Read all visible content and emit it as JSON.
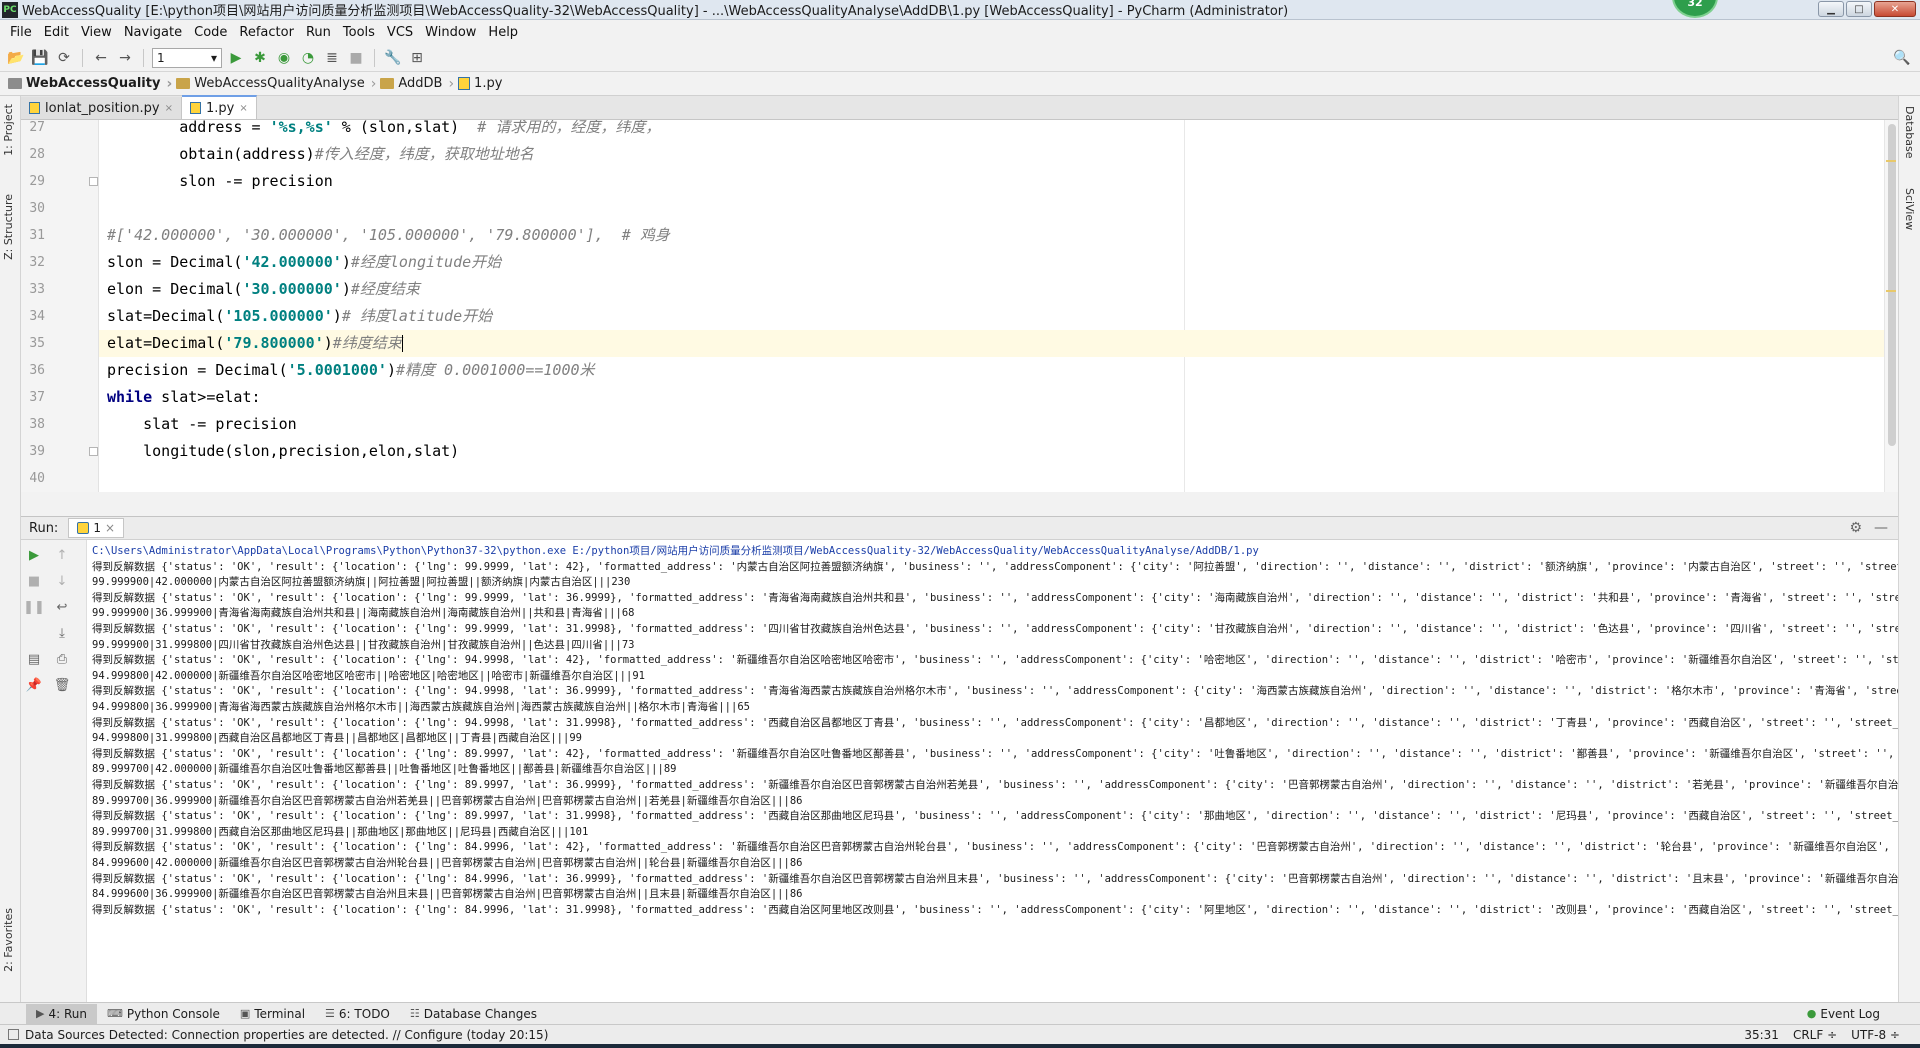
{
  "window": {
    "title": "WebAccessQuality [E:\\python项目\\网站用户访问质量分析监测项目\\WebAccessQuality-32\\WebAccessQuality] - ...\\WebAccessQualityAnalyse\\AddDB\\1.py [WebAccessQuality] - PyCharm (Administrator)",
    "app_icon_label": "PC",
    "badge": "32",
    "controls": {
      "minimize": "▁",
      "maximize": "□",
      "close": "✕"
    }
  },
  "menu": [
    "File",
    "Edit",
    "View",
    "Navigate",
    "Code",
    "Refactor",
    "Run",
    "Tools",
    "VCS",
    "Window",
    "Help"
  ],
  "toolbar": {
    "run_config": "1",
    "icons": [
      "open-icon",
      "save-icon",
      "sync-icon",
      "back-icon",
      "forward-icon",
      "run-icon",
      "debug-icon",
      "coverage-icon",
      "profile-icon",
      "concurrency-icon",
      "stop-icon",
      "settings-icon",
      "structure-icon",
      "search-icon"
    ]
  },
  "breadcrumb": [
    "WebAccessQuality",
    "WebAccessQualityAnalyse",
    "AddDB",
    "1.py"
  ],
  "left_tabs": {
    "project": "1: Project",
    "structure": "Z: Structure",
    "favorites": "2: Favorites"
  },
  "right_tabs": {
    "database": "Database",
    "sciview": "SciView"
  },
  "editor_tabs": [
    {
      "label": "lonlat_position.py",
      "active": false
    },
    {
      "label": "1.py",
      "active": true
    }
  ],
  "code": {
    "lines": [
      {
        "no": "27",
        "parts": [
          {
            "t": "        address = ",
            "c": ""
          },
          {
            "t": "'%s,%s'",
            "c": "str"
          },
          {
            "t": " % (slon,slat)  ",
            "c": ""
          },
          {
            "t": "# 请求用的，经度，纬度，",
            "c": "cmt"
          }
        ]
      },
      {
        "no": "28",
        "parts": [
          {
            "t": "        obtain(address)",
            "c": ""
          },
          {
            "t": "#传入经度，纬度，获取地址地名",
            "c": "cmt"
          }
        ]
      },
      {
        "no": "29",
        "parts": [
          {
            "t": "        slon -= precision",
            "c": ""
          }
        ]
      },
      {
        "no": "30",
        "parts": []
      },
      {
        "no": "31",
        "parts": [
          {
            "t": "#['42.000000', '30.000000', '105.000000', '79.800000'],  # 鸡身",
            "c": "cmt"
          }
        ]
      },
      {
        "no": "32",
        "parts": [
          {
            "t": "slon = Decimal(",
            "c": ""
          },
          {
            "t": "'42.000000'",
            "c": "str"
          },
          {
            "t": ")",
            "c": ""
          },
          {
            "t": "#经度longitude开始",
            "c": "cmt"
          }
        ]
      },
      {
        "no": "33",
        "parts": [
          {
            "t": "elon = Decimal(",
            "c": ""
          },
          {
            "t": "'30.000000'",
            "c": "str"
          },
          {
            "t": ")",
            "c": ""
          },
          {
            "t": "#经度结束",
            "c": "cmt"
          }
        ]
      },
      {
        "no": "34",
        "parts": [
          {
            "t": "slat=Decimal(",
            "c": ""
          },
          {
            "t": "'105.000000'",
            "c": "str"
          },
          {
            "t": ")",
            "c": ""
          },
          {
            "t": "# 纬度latitude开始",
            "c": "cmt"
          }
        ]
      },
      {
        "no": "35",
        "parts": [
          {
            "t": "elat=Decimal(",
            "c": ""
          },
          {
            "t": "'79.800000'",
            "c": "str"
          },
          {
            "t": ")",
            "c": ""
          },
          {
            "t": "#纬度结束",
            "c": "cmt"
          }
        ],
        "current": true
      },
      {
        "no": "36",
        "parts": [
          {
            "t": "precision = Decimal(",
            "c": ""
          },
          {
            "t": "'5.0001000'",
            "c": "str"
          },
          {
            "t": ")",
            "c": ""
          },
          {
            "t": "#精度 0.0001000==1000米",
            "c": "cmt"
          }
        ]
      },
      {
        "no": "37",
        "parts": [
          {
            "t": "while",
            "c": "kw"
          },
          {
            "t": " slat>=elat:",
            "c": ""
          }
        ]
      },
      {
        "no": "38",
        "parts": [
          {
            "t": "    slat -= precision",
            "c": ""
          }
        ]
      },
      {
        "no": "39",
        "parts": [
          {
            "t": "    longitude(slon,precision,elon,slat)",
            "c": ""
          }
        ]
      },
      {
        "no": "40",
        "parts": []
      }
    ]
  },
  "run_panel": {
    "label": "Run:",
    "tab": "1",
    "close": "×"
  },
  "console": {
    "lines": [
      {
        "cls": "cmd",
        "text": "C:\\Users\\Administrator\\AppData\\Local\\Programs\\Python\\Python37-32\\python.exe E:/python项目/网站用户访问质量分析监测项目/WebAccessQuality-32/WebAccessQuality/WebAccessQualityAnalyse/AddDB/1.py"
      },
      {
        "cls": "",
        "text": "得到反解数据 {'status': 'OK', 'result': {'location': {'lng': 99.9999, 'lat': 42}, 'formatted_address': '内蒙古自治区阿拉善盟额济纳旗', 'business': '', 'addressComponent': {'city': '阿拉善盟', 'direction': '', 'distance': '', 'district': '额济纳旗', 'province': '内蒙古自治区', 'street': '', 'street_nu"
      },
      {
        "cls": "",
        "text": "99.999900|42.000000|内蒙古自治区阿拉善盟额济纳旗||阿拉善盟|阿拉善盟||额济纳旗|内蒙古自治区|||230"
      },
      {
        "cls": "",
        "text": "得到反解数据 {'status': 'OK', 'result': {'location': {'lng': 99.9999, 'lat': 36.9999}, 'formatted_address': '青海省海南藏族自治州共和县', 'business': '', 'addressComponent': {'city': '海南藏族自治州', 'direction': '', 'distance': '', 'district': '共和县', 'province': '青海省', 'street': '', 'street_n"
      },
      {
        "cls": "",
        "text": "99.999900|36.999900|青海省海南藏族自治州共和县||海南藏族自治州|海南藏族自治州||共和县|青海省|||68"
      },
      {
        "cls": "",
        "text": "得到反解数据 {'status': 'OK', 'result': {'location': {'lng': 99.9999, 'lat': 31.9998}, 'formatted_address': '四川省甘孜藏族自治州色达县', 'business': '', 'addressComponent': {'city': '甘孜藏族自治州', 'direction': '', 'distance': '', 'district': '色达县', 'province': '四川省', 'street': '', 'street_n"
      },
      {
        "cls": "",
        "text": "99.999900|31.999800|四川省甘孜藏族自治州色达县||甘孜藏族自治州|甘孜藏族自治州||色达县|四川省|||73"
      },
      {
        "cls": "",
        "text": "得到反解数据 {'status': 'OK', 'result': {'location': {'lng': 94.9998, 'lat': 42}, 'formatted_address': '新疆维吾尔自治区哈密地区哈密市', 'business': '', 'addressComponent': {'city': '哈密地区', 'direction': '', 'distance': '', 'district': '哈密市', 'province': '新疆维吾尔自治区', 'street': '', 'stree"
      },
      {
        "cls": "",
        "text": "94.999800|42.000000|新疆维吾尔自治区哈密地区哈密市||哈密地区|哈密地区||哈密市|新疆维吾尔自治区|||91"
      },
      {
        "cls": "",
        "text": "得到反解数据 {'status': 'OK', 'result': {'location': {'lng': 94.9998, 'lat': 36.9999}, 'formatted_address': '青海省海西蒙古族藏族自治州格尔木市', 'business': '', 'addressComponent': {'city': '海西蒙古族藏族自治州', 'direction': '', 'distance': '', 'district': '格尔木市', 'province': '青海省', 'street"
      },
      {
        "cls": "",
        "text": "94.999800|36.999900|青海省海西蒙古族藏族自治州格尔木市||海西蒙古族藏族自治州|海西蒙古族藏族自治州||格尔木市|青海省|||65"
      },
      {
        "cls": "",
        "text": "得到反解数据 {'status': 'OK', 'result': {'location': {'lng': 94.9998, 'lat': 31.9998}, 'formatted_address': '西藏自治区昌都地区丁青县', 'business': '', 'addressComponent': {'city': '昌都地区', 'direction': '', 'distance': '', 'district': '丁青县', 'province': '西藏自治区', 'street': '', 'street_numbe"
      },
      {
        "cls": "",
        "text": "94.999800|31.999800|西藏自治区昌都地区丁青县||昌都地区|昌都地区||丁青县|西藏自治区|||99"
      },
      {
        "cls": "",
        "text": "得到反解数据 {'status': 'OK', 'result': {'location': {'lng': 89.9997, 'lat': 42}, 'formatted_address': '新疆维吾尔自治区吐鲁番地区鄯善县', 'business': '', 'addressComponent': {'city': '吐鲁番地区', 'direction': '', 'distance': '', 'district': '鄯善县', 'province': '新疆维吾尔自治区', 'street': '', 's"
      },
      {
        "cls": "",
        "text": "89.999700|42.000000|新疆维吾尔自治区吐鲁番地区鄯善县||吐鲁番地区|吐鲁番地区||鄯善县|新疆维吾尔自治区|||89"
      },
      {
        "cls": "",
        "text": "得到反解数据 {'status': 'OK', 'result': {'location': {'lng': 89.9997, 'lat': 36.9999}, 'formatted_address': '新疆维吾尔自治区巴音郭楞蒙古自治州若羌县', 'business': '', 'addressComponent': {'city': '巴音郭楞蒙古自治州', 'direction': '', 'distance': '', 'district': '若羌县', 'province': '新疆维吾尔自治"
      },
      {
        "cls": "",
        "text": "89.999700|36.999900|新疆维吾尔自治区巴音郭楞蒙古自治州若羌县||巴音郭楞蒙古自治州|巴音郭楞蒙古自治州||若羌县|新疆维吾尔自治区|||86"
      },
      {
        "cls": "",
        "text": "得到反解数据 {'status': 'OK', 'result': {'location': {'lng': 89.9997, 'lat': 31.9998}, 'formatted_address': '西藏自治区那曲地区尼玛县', 'business': '', 'addressComponent': {'city': '那曲地区', 'direction': '', 'distance': '', 'district': '尼玛县', 'province': '西藏自治区', 'street': '', 'street_numbe"
      },
      {
        "cls": "",
        "text": "89.999700|31.999800|西藏自治区那曲地区尼玛县||那曲地区|那曲地区||尼玛县|西藏自治区|||101"
      },
      {
        "cls": "",
        "text": "得到反解数据 {'status': 'OK', 'result': {'location': {'lng': 84.9996, 'lat': 42}, 'formatted_address': '新疆维吾尔自治区巴音郭楞蒙古自治州轮台县', 'business': '', 'addressComponent': {'city': '巴音郭楞蒙古自治州', 'direction': '', 'distance': '', 'district': '轮台县', 'province': '新疆维吾尔自治区', "
      },
      {
        "cls": "",
        "text": "84.999600|42.000000|新疆维吾尔自治区巴音郭楞蒙古自治州轮台县||巴音郭楞蒙古自治州|巴音郭楞蒙古自治州||轮台县|新疆维吾尔自治区|||86"
      },
      {
        "cls": "",
        "text": "得到反解数据 {'status': 'OK', 'result': {'location': {'lng': 84.9996, 'lat': 36.9999}, 'formatted_address': '新疆维吾尔自治区巴音郭楞蒙古自治州且末县', 'business': '', 'addressComponent': {'city': '巴音郭楞蒙古自治州', 'direction': '', 'distance': '', 'district': '且末县', 'province': '新疆维吾尔自治"
      },
      {
        "cls": "",
        "text": "84.999600|36.999900|新疆维吾尔自治区巴音郭楞蒙古自治州且末县||巴音郭楞蒙古自治州|巴音郭楞蒙古自治州||且末县|新疆维吾尔自治区|||86"
      },
      {
        "cls": "",
        "text": "得到反解数据 {'status': 'OK', 'result': {'location': {'lng': 84.9996, 'lat': 31.9998}, 'formatted_address': '西藏自治区阿里地区改则县', 'business': '', 'addressComponent': {'city': '阿里地区', 'direction': '', 'distance': '', 'district': '改则县', 'province': '西藏自治区', 'street': '', 'street_numbe"
      }
    ]
  },
  "bottom_tabs": [
    {
      "label": "4: Run",
      "icon": "▶",
      "active": true
    },
    {
      "label": "Python Console",
      "icon": "⌨",
      "active": false
    },
    {
      "label": "Terminal",
      "icon": "▣",
      "active": false
    },
    {
      "label": "6: TODO",
      "icon": "☰",
      "active": false
    },
    {
      "label": "Database Changes",
      "icon": "☷",
      "active": false
    }
  ],
  "event_log": "Event Log",
  "status": {
    "message": "Data Sources Detected: Connection properties are detected. // Configure (today 20:15)",
    "position": "35:31",
    "line_sep": "CRLF ÷",
    "encoding": "UTF-8 ÷"
  }
}
